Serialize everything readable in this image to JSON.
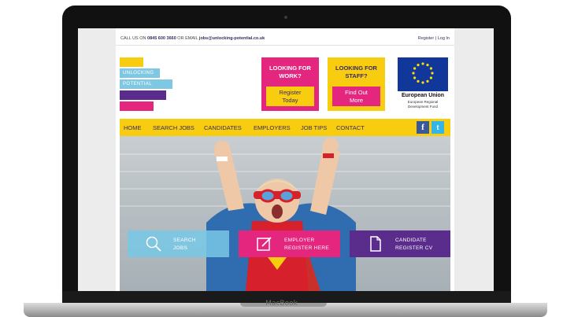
{
  "device": {
    "brand": "MacBook"
  },
  "topbar": {
    "phone_prefix": "CALL US ON",
    "phone": "0845 600 3660",
    "email_prefix": "OR EMAIL",
    "email": "jobs@unlocking-potential.co.uk",
    "register": "Register",
    "separator": "|",
    "login": "Log In"
  },
  "logo": {
    "line1": "UNLOCKING",
    "line2": "POTENTIAL",
    "colors": [
      "#f8cd0f",
      "#7ec8e3",
      "#7ec8e3",
      "#5a2d8c",
      "#e5267f"
    ]
  },
  "cta_work": {
    "heading_line1": "LOOKING FOR",
    "heading_line2": "WORK?",
    "button_line1": "Register",
    "button_line2": "Today"
  },
  "cta_staff": {
    "heading_line1": "LOOKING FOR",
    "heading_line2": "STAFF?",
    "button_line1": "Find Out",
    "button_line2": "More"
  },
  "eu": {
    "title": "European Union",
    "subtitle_line1": "European Regional",
    "subtitle_line2": "Development Fund"
  },
  "nav": {
    "items": [
      "HOME",
      "SEARCH JOBS",
      "CANDIDATES",
      "EMPLOYERS",
      "JOB TIPS",
      "CONTACT"
    ]
  },
  "social": {
    "facebook": "f",
    "twitter": "t"
  },
  "tiles": [
    {
      "line1": "SEARCH",
      "line2": "JOBS",
      "icon": "magnifier-icon"
    },
    {
      "line1": "EMPLOYER",
      "line2": "REGISTER HERE",
      "icon": "edit-icon"
    },
    {
      "line1": "CANDIDATE",
      "line2": "REGISTER CV",
      "icon": "document-icon"
    }
  ],
  "colors": {
    "magenta": "#e5267f",
    "yellow": "#f8cd0f",
    "purple": "#5a2d8c",
    "light_blue": "#7ec8e3",
    "navy_text": "#3a2a5e"
  }
}
